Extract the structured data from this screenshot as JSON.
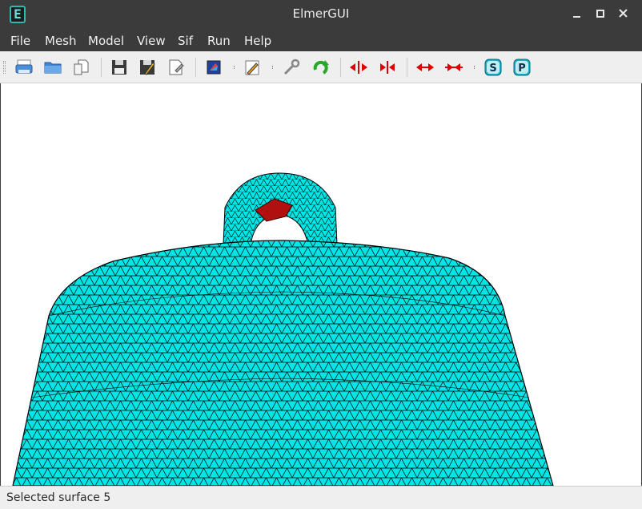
{
  "window": {
    "title": "ElmerGUI",
    "app_icon_letter": "E"
  },
  "menu": {
    "items": [
      {
        "label": "File",
        "accel": "F"
      },
      {
        "label": "Mesh",
        "accel": "M"
      },
      {
        "label": "Model",
        "accel": "M"
      },
      {
        "label": "View",
        "accel": "V"
      },
      {
        "label": "Sif",
        "accel": "S"
      },
      {
        "label": "Run",
        "accel": "R"
      },
      {
        "label": "Help",
        "accel": "H"
      }
    ]
  },
  "toolbar": {
    "buttons": [
      {
        "icon": "print-icon",
        "tooltip": ""
      },
      {
        "icon": "open-folder-icon",
        "tooltip": ""
      },
      {
        "icon": "copy-document-icon",
        "tooltip": ""
      },
      {
        "icon": "save-icon",
        "tooltip": ""
      },
      {
        "icon": "save-as-icon",
        "tooltip": ""
      },
      {
        "icon": "edit-document-icon",
        "tooltip": ""
      },
      {
        "icon": "model-icon",
        "tooltip": ""
      },
      {
        "icon": "pencil-icon",
        "tooltip": ""
      },
      {
        "icon": "wrench-icon",
        "tooltip": ""
      },
      {
        "icon": "refresh-icon",
        "tooltip": ""
      },
      {
        "icon": "divide-icon",
        "tooltip": ""
      },
      {
        "icon": "unify-icon",
        "tooltip": ""
      },
      {
        "icon": "divide-edge-icon",
        "tooltip": ""
      },
      {
        "icon": "unify-edge-icon",
        "tooltip": ""
      },
      {
        "icon": "solver-s-icon",
        "label": "S"
      },
      {
        "icon": "postprocessor-p-icon",
        "label": "P"
      }
    ]
  },
  "viewport": {
    "mesh_color": "#00e5e5",
    "edge_color": "#000000",
    "selected_color": "#b01010",
    "background": "#ffffff"
  },
  "status": {
    "text": "Selected surface 5"
  }
}
